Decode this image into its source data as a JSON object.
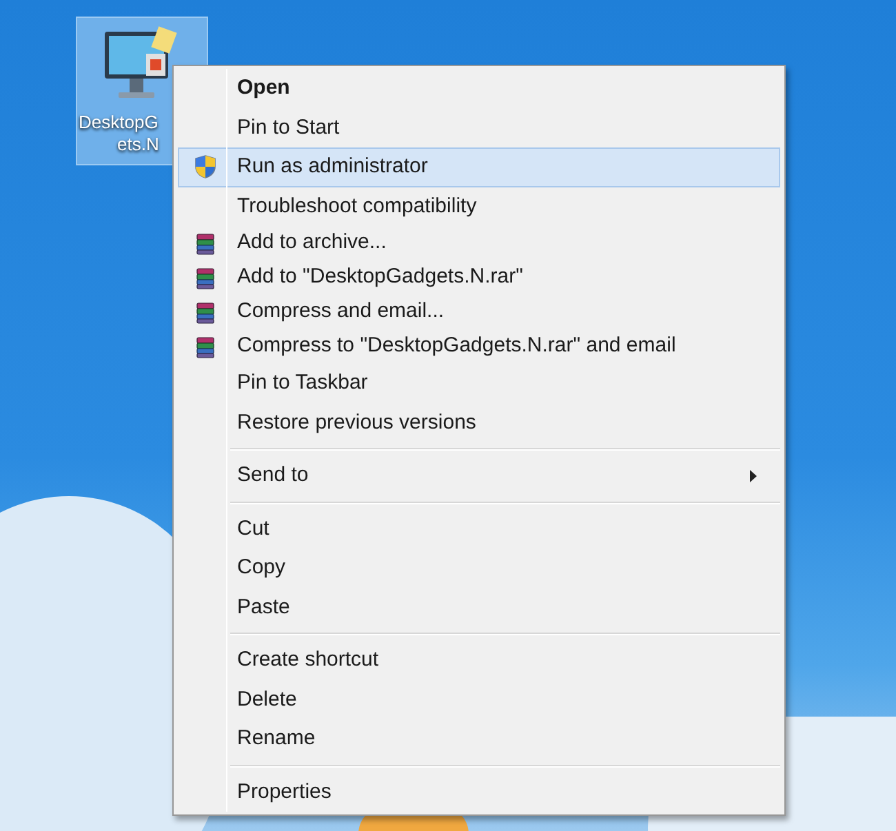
{
  "desktop_icon": {
    "label_lines": [
      "DesktopG",
      "ets.N"
    ],
    "selected": true
  },
  "context_menu": {
    "groups": [
      {
        "items": [
          {
            "label": "Open",
            "kind": "plain",
            "default": true,
            "selected": false
          },
          {
            "label": "Pin to Start",
            "kind": "plain",
            "default": false,
            "selected": false
          },
          {
            "label": "Run as administrator",
            "kind": "shield",
            "default": false,
            "selected": true
          },
          {
            "label": "Troubleshoot compatibility",
            "kind": "plain",
            "default": false,
            "selected": false
          },
          {
            "label": "Add to archive...",
            "kind": "archive",
            "default": false,
            "selected": false
          },
          {
            "label": "Add to \"DesktopGadgets.N.rar\"",
            "kind": "archive",
            "default": false,
            "selected": false
          },
          {
            "label": "Compress and email...",
            "kind": "archive",
            "default": false,
            "selected": false
          },
          {
            "label": "Compress to \"DesktopGadgets.N.rar\" and email",
            "kind": "archive",
            "default": false,
            "selected": false
          },
          {
            "label": "Pin to Taskbar",
            "kind": "plain",
            "default": false,
            "selected": false
          },
          {
            "label": "Restore previous versions",
            "kind": "plain",
            "default": false,
            "selected": false
          }
        ]
      },
      {
        "items": [
          {
            "label": "Send to",
            "kind": "submenu",
            "default": false,
            "selected": false
          }
        ]
      },
      {
        "items": [
          {
            "label": "Cut",
            "kind": "plain",
            "default": false,
            "selected": false
          },
          {
            "label": "Copy",
            "kind": "plain",
            "default": false,
            "selected": false
          },
          {
            "label": "Paste",
            "kind": "plain",
            "default": false,
            "selected": false
          }
        ]
      },
      {
        "items": [
          {
            "label": "Create shortcut",
            "kind": "plain",
            "default": false,
            "selected": false
          },
          {
            "label": "Delete",
            "kind": "plain",
            "default": false,
            "selected": false
          },
          {
            "label": "Rename",
            "kind": "plain",
            "default": false,
            "selected": false
          }
        ]
      },
      {
        "items": [
          {
            "label": "Properties",
            "kind": "plain",
            "default": false,
            "selected": false
          }
        ]
      }
    ]
  }
}
